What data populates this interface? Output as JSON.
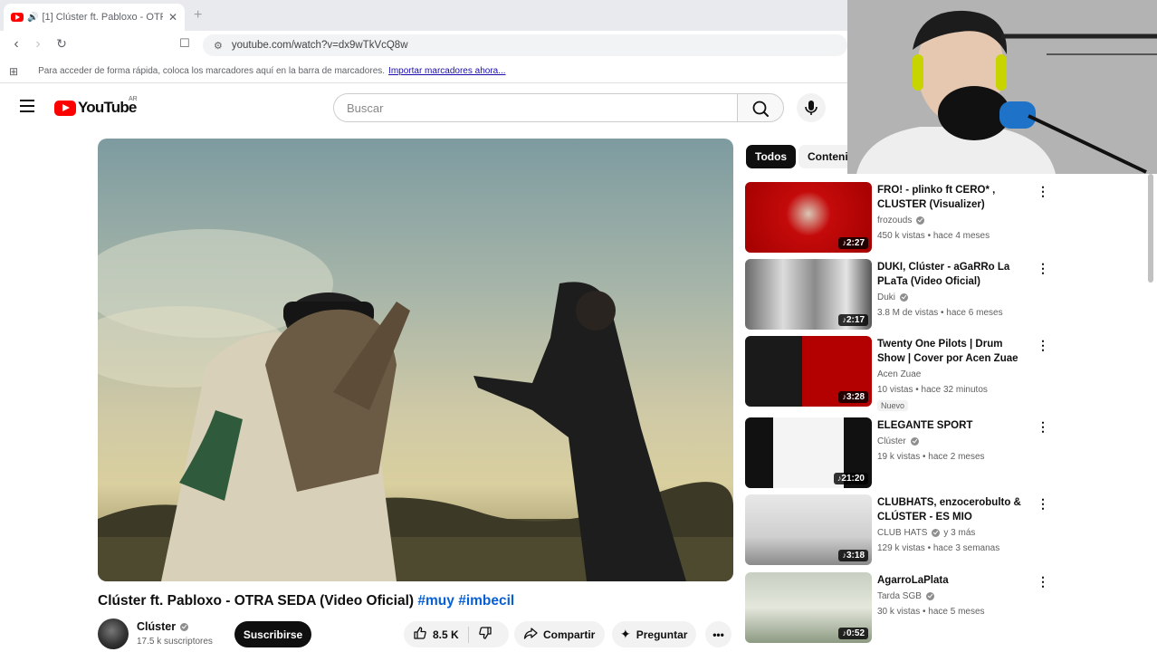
{
  "browser": {
    "tab_title": "[1] Clúster ft. Pabloxo - OTR",
    "url": "youtube.com/watch?v=dx9wTkVcQ8w",
    "bookmark_bar_text": "Para acceder de forma rápida, coloca los marcadores aquí en la barra de marcadores.",
    "bookmark_bar_link": "Importar marcadores ahora..."
  },
  "header": {
    "logo_text": "YouTube",
    "country_code": "AR",
    "search_placeholder": "Buscar"
  },
  "video": {
    "title": "Clúster ft. Pabloxo - OTRA SEDA (Video Oficial)",
    "hashtags": [
      "#muy",
      "#imbecil"
    ],
    "channel_name": "Clúster",
    "subscribers": "17.5 k suscriptores",
    "subscribe_label": "Suscribirse",
    "likes": "8.5 K",
    "share_label": "Compartir",
    "ask_label": "Preguntar"
  },
  "sidebar": {
    "chips": [
      "Todos",
      "Contenido"
    ],
    "recommendations": [
      {
        "title": "FRO! - plinko ft CERO* , CLUSTER (Visualizer)",
        "channel": "frozouds",
        "verified": true,
        "meta": "450 k vistas • hace 4 meses",
        "duration": "2:27",
        "badge": ""
      },
      {
        "title": "DUKI, Clúster - aGaRRo La PLaTa (Video Oficial)",
        "channel": "Duki",
        "verified": true,
        "meta": "3.8 M de vistas • hace 6 meses",
        "duration": "2:17",
        "badge": ""
      },
      {
        "title": "Twenty One Pilots | Drum Show | Cover por Acen Zuae",
        "channel": "Acen Zuae",
        "verified": false,
        "meta": "10 vistas • hace 32 minutos",
        "duration": "3:28",
        "badge": "Nuevo"
      },
      {
        "title": "ELEGANTE SPORT",
        "channel": "Clúster",
        "verified": true,
        "meta": "19 k vistas • hace 2 meses",
        "duration": "21:20",
        "badge": ""
      },
      {
        "title": "CLUBHATS, enzocerobulto & CLÚSTER - ES MIO",
        "channel": "CLUB HATS",
        "verified": true,
        "channel_suffix": "y 3 más",
        "meta": "129 k vistas • hace 3 semanas",
        "duration": "3:18",
        "badge": ""
      },
      {
        "title": "AgarroLaPlata",
        "channel": "Tarda SGB",
        "verified": true,
        "meta": "30 k vistas • hace 5 meses",
        "duration": "0:52",
        "badge": ""
      }
    ]
  },
  "colors": {
    "youtube_red": "#ff0000",
    "link_blue": "#065fd4",
    "chip_active": "#0f0f0f"
  }
}
